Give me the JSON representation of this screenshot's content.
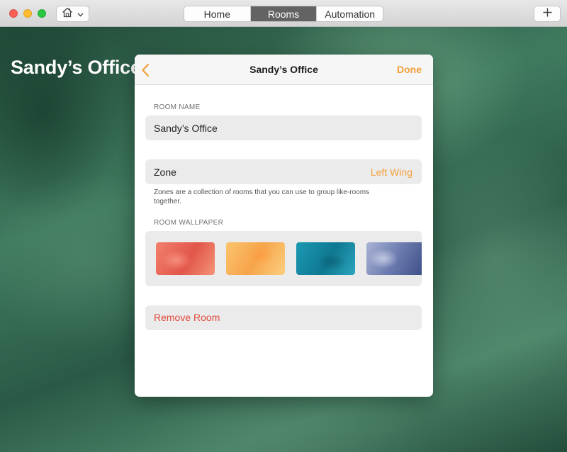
{
  "toolbar": {
    "home_icon": "house-icon",
    "home_dropdown_icon": "chevron-down-icon",
    "tabs": [
      "Home",
      "Rooms",
      "Automation"
    ],
    "active_tab": "Rooms",
    "add_icon": "plus-icon"
  },
  "background": {
    "room_title": "Sandy’s Office"
  },
  "modal": {
    "back_icon": "chevron-left-icon",
    "title": "Sandy’s Office",
    "done_label": "Done",
    "room_name_label": "ROOM NAME",
    "room_name_value": "Sandy’s Office",
    "zone_label": "Zone",
    "zone_value": "Left Wing",
    "zone_help": "Zones are a collection of rooms that you can use to group like-rooms together.",
    "wallpaper_label": "ROOM WALLPAPER",
    "wallpapers": [
      "coral",
      "amber",
      "teal",
      "indigo"
    ],
    "remove_label": "Remove Room"
  },
  "colors": {
    "accent": "#f2a03a",
    "destructive": "#e04a3c",
    "segment_active": "#636363"
  }
}
